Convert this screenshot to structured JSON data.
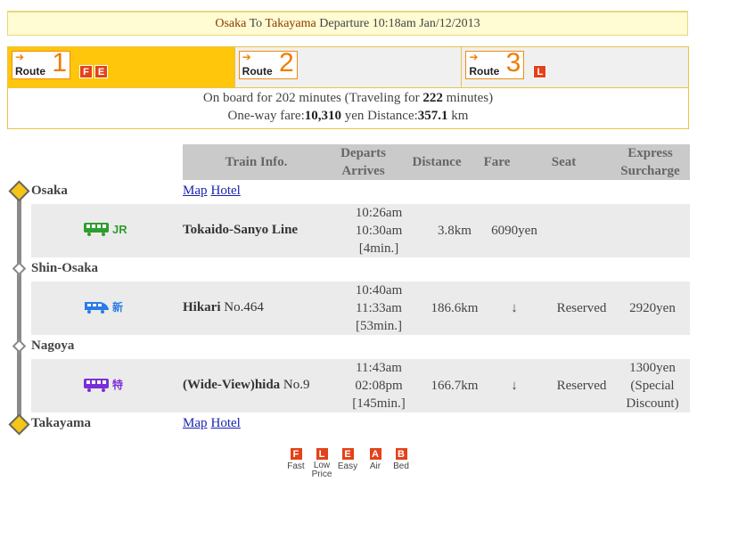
{
  "header": {
    "origin": "Osaka",
    "to": "To",
    "destination": "Takayama",
    "departure": "Departure 10:18am Jan/12/2013"
  },
  "routes": [
    {
      "label": "Route",
      "num": "1",
      "badges": [
        "F",
        "E"
      ],
      "active": true
    },
    {
      "label": "Route",
      "num": "2",
      "badges": [],
      "active": false
    },
    {
      "label": "Route",
      "num": "3",
      "badges": [
        "L"
      ],
      "active": false
    }
  ],
  "summary": {
    "onboard_prefix": "On board for 202 minutes (Traveling for ",
    "traveling_minutes": "222",
    "onboard_suffix": " minutes)",
    "fare_prefix": "One-way fare:",
    "fare": "10,310",
    "yen_distance": " yen Distance:",
    "distance": "357.1",
    "km": " km"
  },
  "table_header": {
    "train_info": "Train Info.",
    "departs": "Departs",
    "arrives": "Arrives",
    "distance": "Distance",
    "fare": "Fare",
    "seat": "Seat",
    "express": "Express",
    "surcharge": "Surcharge"
  },
  "links": {
    "map": "Map",
    "hotel": "Hotel"
  },
  "stations": [
    "Osaka",
    "Shin-Osaka",
    "Nagoya",
    "Takayama"
  ],
  "segments": [
    {
      "icon": "jr-train-icon",
      "icon_color": "#2e9e2e",
      "icon_text": "JR",
      "train_bold": "Tokaido-Sanyo Line",
      "train_rest": "",
      "depart": "10:26am",
      "arrive": "10:30am",
      "duration": "[4min.]",
      "distance": "3.8km",
      "fare": "6090yen",
      "seat": "",
      "surcharge": ""
    },
    {
      "icon": "shinkansen-icon",
      "icon_color": "#2a7be4",
      "icon_text": "新",
      "train_bold": "Hikari",
      "train_rest": " No.464",
      "depart": "10:40am",
      "arrive": "11:33am",
      "duration": "[53min.]",
      "distance": "186.6km",
      "fare": "↓",
      "seat": "Reserved",
      "surcharge": "2920yen"
    },
    {
      "icon": "limited-express-icon",
      "icon_color": "#7a2fd6",
      "icon_text": "特",
      "train_bold": "(Wide-View)hida",
      "train_rest": " No.9",
      "depart": "11:43am",
      "arrive": "02:08pm",
      "duration": "[145min.]",
      "distance": "166.7km",
      "fare": "↓",
      "seat": "Reserved",
      "surcharge": "1300yen (Special Discount)"
    }
  ],
  "legend": [
    {
      "letter": "F",
      "label": "Fast"
    },
    {
      "letter": "L",
      "label": "Low Price"
    },
    {
      "letter": "E",
      "label": "Easy"
    },
    {
      "letter": "A",
      "label": "Air"
    },
    {
      "letter": "B",
      "label": "Bed"
    }
  ],
  "colors": {
    "accent": "#ffc60b",
    "badge": "#e3421a",
    "route_orange": "#f07c00",
    "link": "#1a23b0"
  }
}
